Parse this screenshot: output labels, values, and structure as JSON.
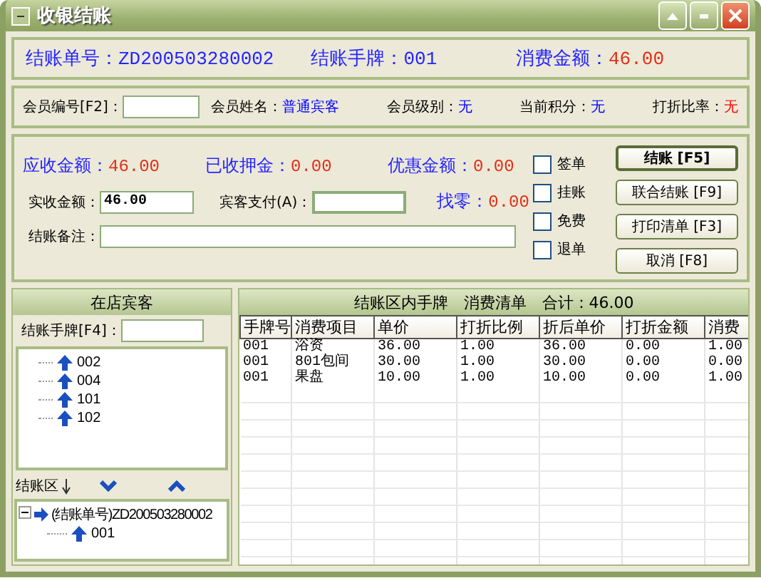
{
  "window": {
    "title": "收银结账"
  },
  "header": {
    "bill_no_label": "结账单号：",
    "bill_no": "ZD200503280002",
    "tag_label": "结账手牌：",
    "tag": "001",
    "amount_label": "消费金额：",
    "amount": "46.00"
  },
  "member": {
    "id_label": "会员编号[F2]：",
    "fields": [
      {
        "label": "会员姓名：",
        "value": "普通宾客",
        "color": "#0000ff"
      },
      {
        "label": "会员级别：",
        "value": "无",
        "color": "#0000ff"
      },
      {
        "label": "当前积分：",
        "value": "无",
        "color": "#0000ff"
      },
      {
        "label": "打折比率：",
        "value": "无",
        "color": "#ff0000"
      }
    ]
  },
  "amounts": [
    {
      "label": "应收金额：",
      "value": "46.00"
    },
    {
      "label": "已收押金：",
      "value": "0.00"
    },
    {
      "label": "优惠金额：",
      "value": "0.00"
    }
  ],
  "payment": {
    "received_label": "实收金额：",
    "received": "46.00",
    "guest_pay_label": "宾客支付(A)：",
    "change_label": "找零：",
    "change": "0.00",
    "remark_label": "结账备注："
  },
  "options": [
    {
      "label": "签单",
      "checked": false
    },
    {
      "label": "挂账",
      "checked": false
    },
    {
      "label": "免费",
      "checked": false
    },
    {
      "label": "退单",
      "checked": false
    }
  ],
  "buttons": [
    {
      "label": "结账 [F5]",
      "default": true
    },
    {
      "label": "联合结账 [F9]",
      "default": false
    },
    {
      "label": "打印清单 [F3]",
      "default": false
    },
    {
      "label": "取消 [F8]",
      "default": false
    }
  ],
  "guests": {
    "title": "在店宾客",
    "search_label": "结账手牌[F4]：",
    "tags": [
      {
        "label": "002"
      },
      {
        "label": "004"
      },
      {
        "label": "101"
      },
      {
        "label": "102"
      }
    ]
  },
  "settle": {
    "label": "结账区",
    "tree": [
      {
        "label": "(结账单号)ZD200503280002",
        "expanded": true,
        "children": [
          {
            "label": "001"
          }
        ]
      }
    ]
  },
  "bill": {
    "title": "结账区内手牌　消费清单　合计：46.00",
    "columns": [
      "手牌号",
      "消费项目",
      "单价",
      "打折比例",
      "折后单价",
      "打折金额",
      "消费"
    ],
    "rows": [
      [
        "001",
        "浴资",
        "36.00",
        "1.00",
        "36.00",
        "0.00",
        "1.00"
      ],
      [
        "001",
        "801包间",
        "30.00",
        "1.00",
        "30.00",
        "0.00",
        "0.00"
      ],
      [
        "001",
        "果盘",
        "10.00",
        "1.00",
        "10.00",
        "0.00",
        "1.00"
      ]
    ]
  }
}
